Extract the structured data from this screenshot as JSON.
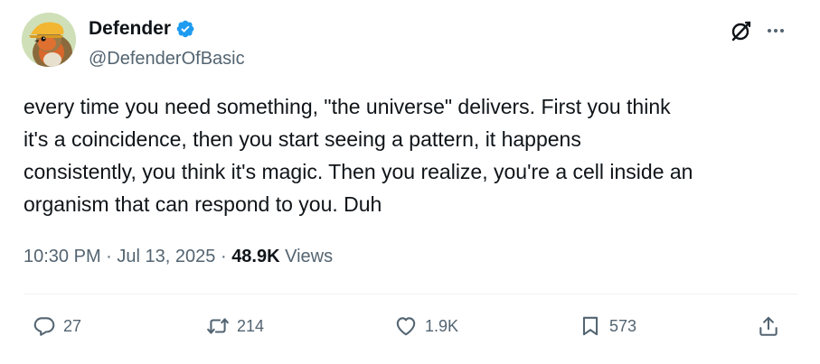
{
  "author": {
    "display_name": "Defender",
    "handle": "@DefenderOfBasic",
    "verified": true,
    "avatar_icon": "robin-bird-avatar"
  },
  "tweet": {
    "text": "every time you need something, \"the universe\" delivers. First you think\nit's a coincidence, then you start seeing a pattern, it happens\nconsistently, you think it's magic. Then you realize, you're a cell inside an\norganism that can respond to you. Duh",
    "time": "10:30 PM",
    "date": "Jul 13, 2025",
    "views_count": "48.9K",
    "views_label": "Views",
    "separator": "·"
  },
  "actions": {
    "reply": {
      "count": "27",
      "icon": "reply-icon"
    },
    "retweet": {
      "count": "214",
      "icon": "retweet-icon"
    },
    "like": {
      "count": "1.9K",
      "icon": "heart-icon"
    },
    "bookmark": {
      "count": "573",
      "icon": "bookmark-icon"
    },
    "share": {
      "icon": "share-icon"
    }
  },
  "header_buttons": {
    "grok": {
      "icon": "grok-icon"
    },
    "more": {
      "icon": "more-icon"
    }
  },
  "colors": {
    "text_primary": "#0f1419",
    "text_secondary": "#536471",
    "verified_blue": "#1d9bf0",
    "divider": "#eff3f4"
  }
}
